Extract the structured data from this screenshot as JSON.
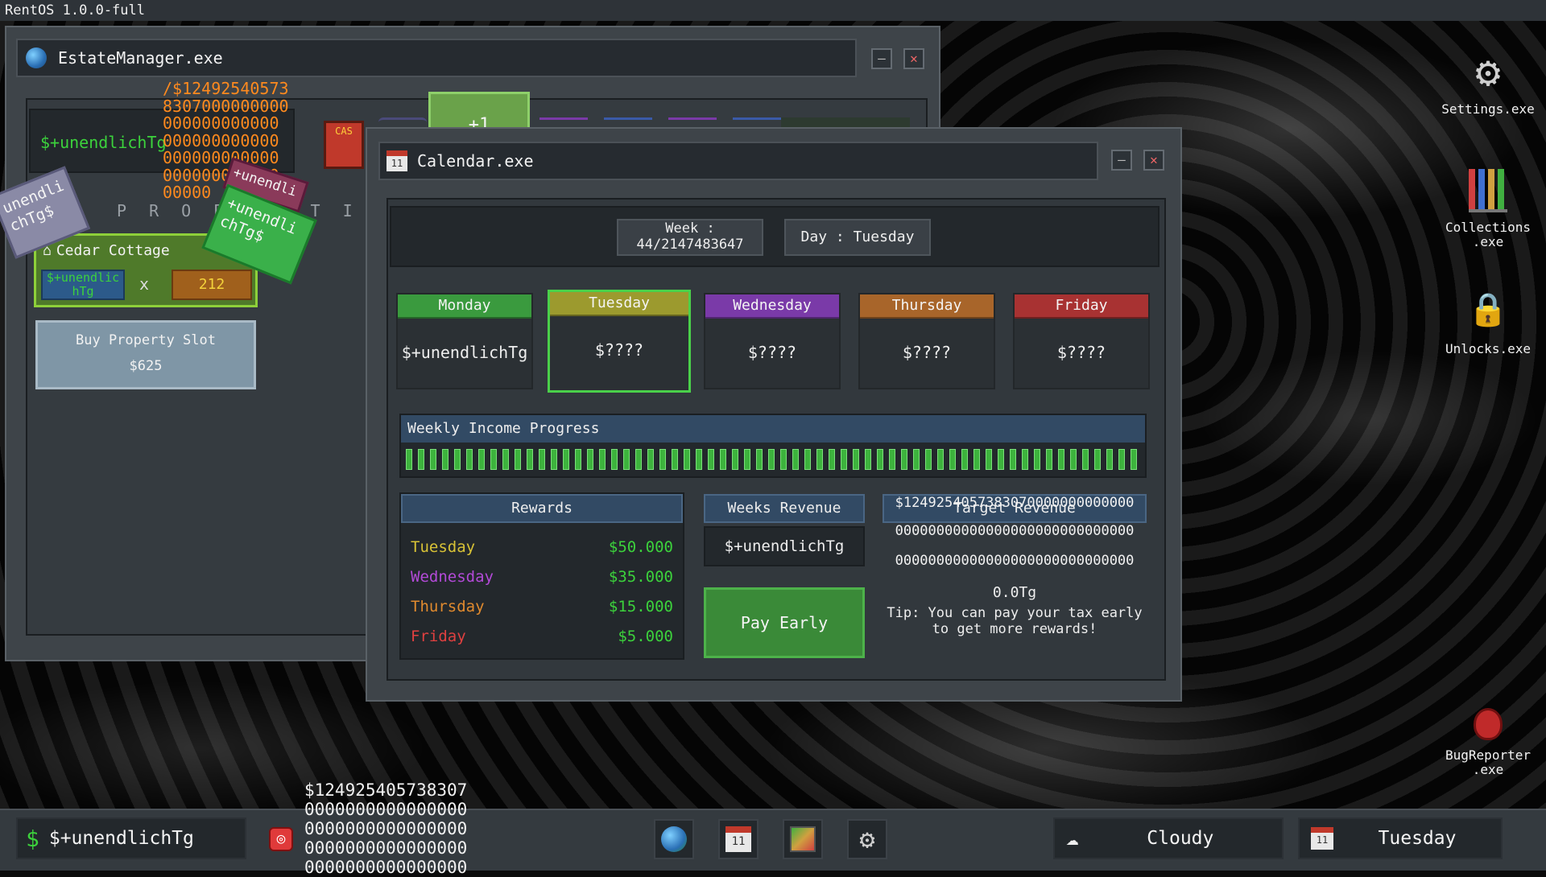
{
  "os_title": "RentOS 1.0.0-full",
  "estate": {
    "title": "EstateManager.exe",
    "balance": "$+unendlichTg",
    "overflow_lines": [
      "/$12492540573",
      "8307000000000",
      "000000000000",
      "000000000000",
      "000000000000",
      "000000000000",
      "00000"
    ],
    "cash_label": "CAS",
    "plus_one": "+1",
    "properties_label": "P R O P E R T I E S",
    "property": {
      "name": "Cedar Cottage",
      "income": "$+unendlic hTg",
      "multiply": "x",
      "count": "212"
    },
    "buy_slot": {
      "label": "Buy Property Slot",
      "price": "$625"
    },
    "floating_tags": [
      "unendli chTg$",
      "+unendli",
      "+unendli chTg$"
    ]
  },
  "calendar": {
    "title": "Calendar.exe",
    "week_label": "Week :",
    "week_value": "44/2147483647",
    "day_label": "Day : Tuesday",
    "days": [
      {
        "name": "Monday",
        "value": "$+unendlichTg",
        "color": "#3a9a3e"
      },
      {
        "name": "Tuesday",
        "value": "$????",
        "color": "#9c9a2e"
      },
      {
        "name": "Wednesday",
        "value": "$????",
        "color": "#7a3aa8"
      },
      {
        "name": "Thursday",
        "value": "$????",
        "color": "#a8652a"
      },
      {
        "name": "Friday",
        "value": "$????",
        "color": "#a83232"
      }
    ],
    "selected_day": "Tuesday",
    "progress_title": "Weekly Income Progress",
    "progress": 1.0,
    "rewards_title": "Rewards",
    "rewards": [
      {
        "day": "Tuesday",
        "amount": "$50.000",
        "color": "#d8c236"
      },
      {
        "day": "Wednesday",
        "amount": "$35.000",
        "color": "#b34ad8"
      },
      {
        "day": "Thursday",
        "amount": "$15.000",
        "color": "#e08a2e"
      },
      {
        "day": "Friday",
        "amount": "$5.000",
        "color": "#e04040"
      }
    ],
    "weeks_revenue_title": "Weeks Revenue",
    "weeks_revenue_value": "$+unendlichTg",
    "pay_early": "Pay Early",
    "target_title": "Target Revenue",
    "target_lines": [
      "$1249254057383070000000000000",
      "00000000000000000000000000000",
      "00000000000000000000000000000"
    ],
    "target_tg": "0.0Tg",
    "tip": "Tip: You can pay your tax early to get more rewards!"
  },
  "desktop_icons": [
    {
      "label": "Settings.exe",
      "icon": "gear-icon"
    },
    {
      "label": "Collections .exe",
      "icon": "collections-icon"
    },
    {
      "label": "Unlocks.exe",
      "icon": "lock-icon"
    },
    {
      "label": "BugReporter .exe",
      "icon": "bug-icon"
    }
  ],
  "taskbar": {
    "balance": "$+unendlichTg",
    "overflow_lines": [
      "$124925405738307",
      "0000000000000000",
      "0000000000000000",
      "0000000000000000",
      "0000000000000000"
    ],
    "weather": "Cloudy",
    "day": "Tuesday"
  }
}
